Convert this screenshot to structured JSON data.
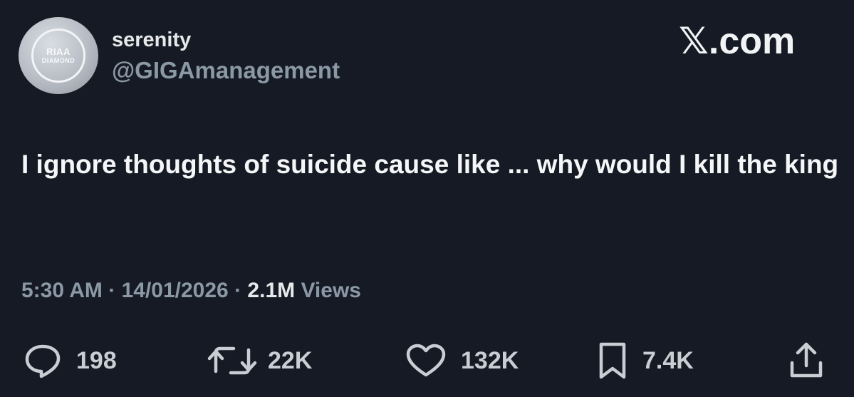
{
  "user": {
    "display_name": "serenity",
    "handle": "@GIGAmanagement",
    "avatar_text_top": "RIAA",
    "avatar_text_bottom": "DIAMOND"
  },
  "brand": {
    "label": "𝕏.com"
  },
  "tweet": {
    "text": "I ignore thoughts of suicide cause like ... why would I kill the king"
  },
  "meta": {
    "time": "5:30 AM",
    "separator": " · ",
    "date": "14/01/2026",
    "views_count": "2.1M",
    "views_label": " Views"
  },
  "actions": {
    "replies": "198",
    "reposts": "22K",
    "likes": "132K",
    "bookmarks": "7.4K"
  },
  "icons": {
    "reply": "reply-icon",
    "repost": "repost-icon",
    "like": "heart-icon",
    "bookmark": "bookmark-icon",
    "share": "share-icon"
  },
  "colors": {
    "background": "#151a24",
    "primary_text": "#e7e9ea",
    "secondary_text": "#8b98a5"
  }
}
